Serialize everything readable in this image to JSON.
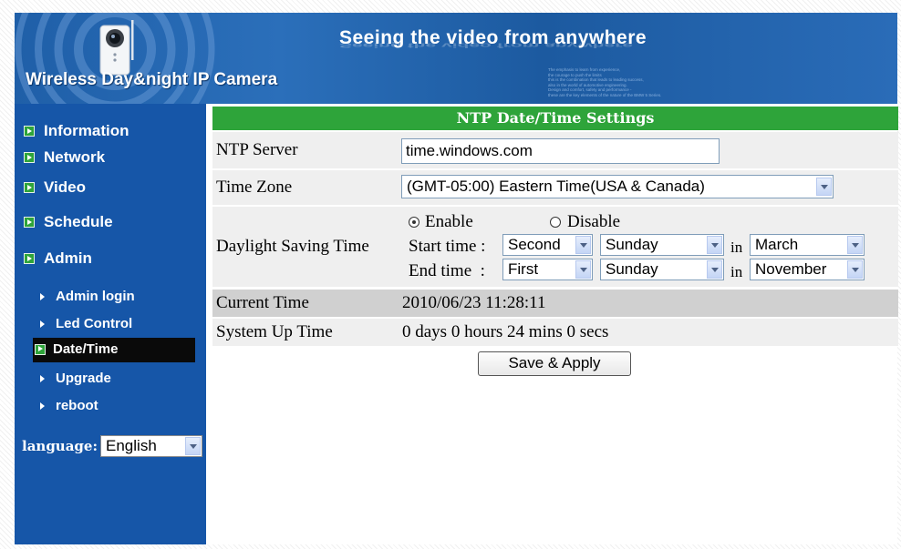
{
  "header": {
    "slogan": "Seeing the video from anywhere",
    "product_name": "Wireless Day&night IP Camera",
    "fine_print": [
      "The emphasis to learn from experience,",
      "the courage to push the limits",
      "this is the combination that leads to leading success,",
      "also in the world of automotive engineering.",
      "Design and comfort, safety and performance -",
      "these are the key elements of the nature of the BMW 5 Series."
    ]
  },
  "sidebar": {
    "main_items": [
      {
        "label": "Information"
      },
      {
        "label": "Network"
      },
      {
        "label": "Video"
      },
      {
        "label": "Schedule"
      },
      {
        "label": "Admin"
      }
    ],
    "sub_items": [
      {
        "label": "Admin login"
      },
      {
        "label": "Led Control"
      },
      {
        "label": "Date/Time",
        "active": true
      },
      {
        "label": "Upgrade"
      },
      {
        "label": "reboot"
      }
    ],
    "language_label": "language:",
    "language_value": "English"
  },
  "content": {
    "title": "NTP Date/Time Settings",
    "ntp_server_label": "NTP Server",
    "ntp_server_value": "time.windows.com",
    "time_zone_label": "Time Zone",
    "time_zone_value": "(GMT-05:00) Eastern Time(USA & Canada)",
    "dst_label": "Daylight Saving Time",
    "enable_label": "Enable",
    "disable_label": "Disable",
    "dst_enabled": true,
    "start_time_label": "Start time :",
    "end_time_label": "End time  :",
    "in_label": "in",
    "start_week": "Second",
    "start_day": "Sunday",
    "start_month": "March",
    "end_week": "First",
    "end_day": "Sunday",
    "end_month": "November",
    "current_time_label": "Current Time",
    "current_time_value": "2010/06/23 11:28:11",
    "uptime_label": "System Up Time",
    "uptime_value": "0 days 0 hours 24 mins 0 secs",
    "save_button": "Save & Apply"
  },
  "colors": {
    "sidebar_blue": "#1656a8",
    "title_green": "#2ea43a",
    "active_item": "#0a0a0a",
    "row_gray": "#efefef",
    "current_time_row": "#d0d0d0"
  }
}
